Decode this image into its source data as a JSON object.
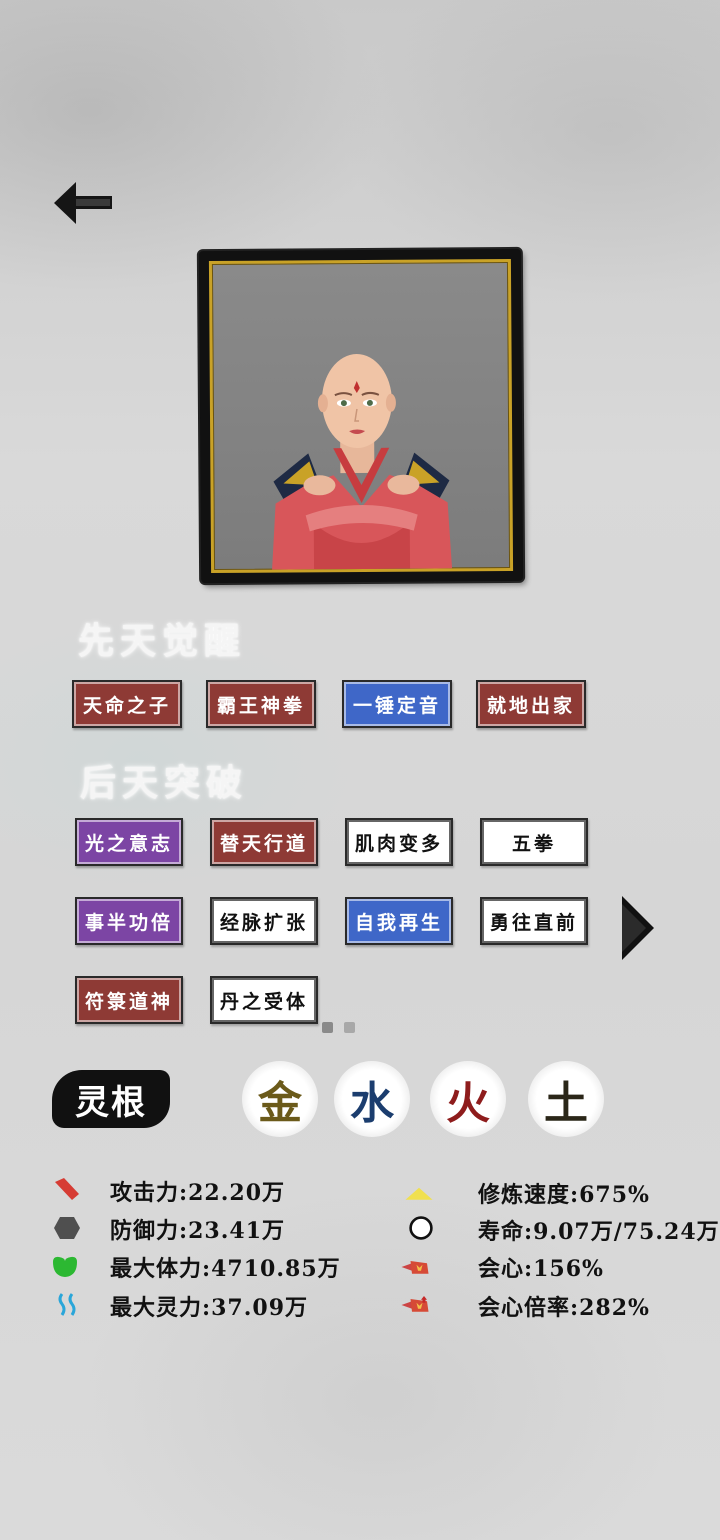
{
  "awakening": {
    "title": "先天觉醒",
    "tags": [
      "天命之子",
      "霸王神拳",
      "一锤定音",
      "就地出家"
    ]
  },
  "breakthrough": {
    "title": "后天突破",
    "tags": [
      "光之意志",
      "替天行道",
      "肌肉变多",
      "五拳",
      "事半功倍",
      "经脉扩张",
      "自我再生",
      "勇往直前",
      "符箓道神",
      "丹之受体"
    ]
  },
  "linggen": {
    "label": "灵根",
    "elements": [
      {
        "char": "金",
        "color": "#6b5a1a"
      },
      {
        "char": "水",
        "color": "#1b3d6e"
      },
      {
        "char": "火",
        "color": "#8e1c1c"
      },
      {
        "char": "土",
        "color": "#2a2618"
      }
    ]
  },
  "stats": {
    "left": [
      {
        "icon": "attack-icon",
        "text": "攻击力:22.20万"
      },
      {
        "icon": "defense-icon",
        "text": "防御力:23.41万"
      },
      {
        "icon": "hp-icon",
        "text": "最大体力:4710.85万"
      },
      {
        "icon": "spirit-icon",
        "text": "最大灵力:37.09万"
      }
    ],
    "right": [
      {
        "icon": "cultivation-speed-icon",
        "text": "修炼速度:675%"
      },
      {
        "icon": "lifespan-icon",
        "text": "寿命:9.07万/75.24万"
      },
      {
        "icon": "crit-icon",
        "text": "会心:156%"
      },
      {
        "icon": "crit-multiplier-icon",
        "text": "会心倍率:282%"
      }
    ]
  },
  "colors": {
    "tag_red": "#8e3a35",
    "tag_blue": "#3f67c8",
    "tag_purple": "#7c45a4",
    "frame_gold": "#c9a227"
  }
}
